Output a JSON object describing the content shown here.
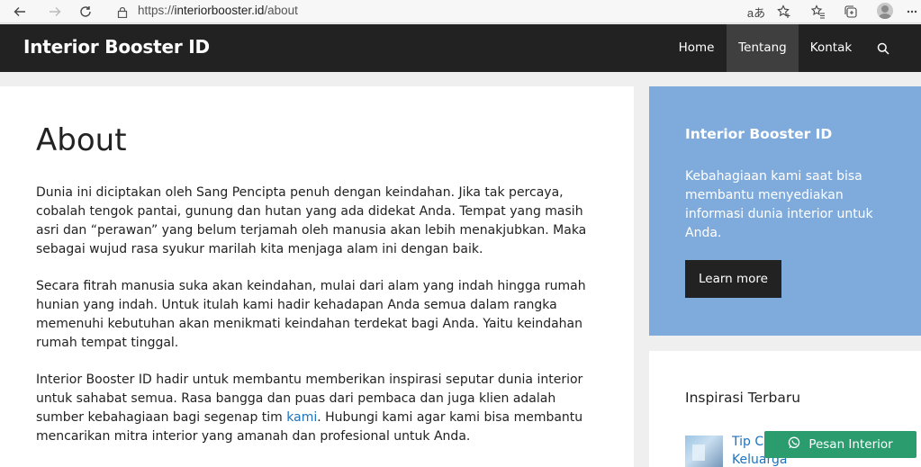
{
  "browser": {
    "url_prefix": "https://",
    "url_domain": "interiorbooster.id",
    "url_path": "/about",
    "read_aloud_label": "aあ"
  },
  "site": {
    "title": "Interior Booster ID",
    "menu": [
      {
        "label": "Home",
        "active": false
      },
      {
        "label": "Tentang",
        "active": true
      },
      {
        "label": "Kontak",
        "active": false
      }
    ]
  },
  "main": {
    "title": "About",
    "paragraphs": [
      "Dunia ini diciptakan oleh Sang Pencipta penuh dengan keindahan. Jika tak percaya, cobalah tengok pantai, gunung dan hutan yang ada didekat Anda. Tempat yang masih asri dan “perawan” yang belum terjamah oleh manusia akan lebih menakjubkan. Maka sebagai wujud rasa syukur marilah kita menjaga alam ini dengan baik.",
      "Secara fitrah manusia suka akan keindahan, mulai dari alam yang indah hingga rumah hunian yang indah. Untuk itulah kami hadir kehadapan Anda semua dalam rangka memenuhi kebutuhan akan menikmati keindahan terdekat bagi Anda. Yaitu keindahan rumah tempat tinggal."
    ],
    "paragraph3_before": "Interior Booster ID hadir untuk membantu memberikan inspirasi seputar dunia interior untuk sahabat semua. Rasa bangga dan puas dari pembaca dan juga klien adalah sumber kebahagiaan bagi segenap tim ",
    "paragraph3_link": "kami",
    "paragraph3_after": ". Hubungi kami agar kami bisa membantu mencarikan mitra interior yang amanah dan profesional untuk Anda."
  },
  "sidebar": {
    "promo_title": "Interior Booster ID",
    "promo_text": "Kebahagiaan kami saat bisa membantu menyediakan informasi dunia interior untuk Anda.",
    "promo_button": "Learn more",
    "recent_title": "Inspirasi Terbaru",
    "recent_item": "Tip Cara Memilih Sofa untuk Keluarga"
  },
  "floating": {
    "wa_label": "Pesan Interior"
  },
  "colors": {
    "header_bg": "#222222",
    "promo_bg": "#7fabdc",
    "link": "#1e73be",
    "wa_button": "#2a9c6e"
  }
}
